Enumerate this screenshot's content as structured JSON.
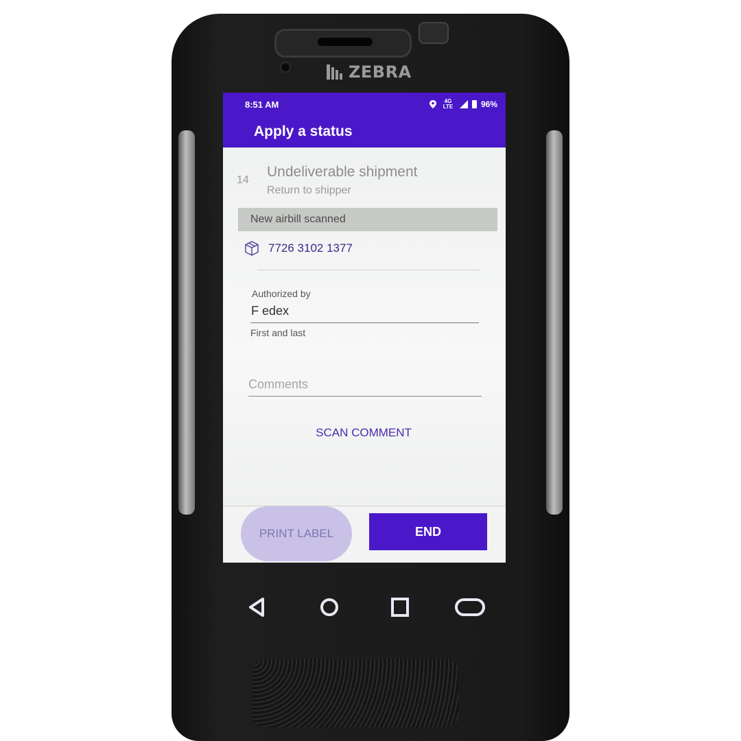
{
  "device": {
    "brand": "ZEBRA"
  },
  "statusbar": {
    "time": "8:51 AM",
    "network": "4G LTE",
    "battery": "96%"
  },
  "appbar": {
    "title": "Apply a status"
  },
  "status": {
    "code": "14",
    "title": "Undeliverable shipment",
    "subtitle": "Return to shipper"
  },
  "section": {
    "label": "New airbill scanned"
  },
  "airbill": {
    "number": "7726 3102 1377",
    "icon": "package-icon"
  },
  "authorized": {
    "label": "Authorized by",
    "value": "F edex",
    "helper": "First and last"
  },
  "comments": {
    "placeholder": "Comments",
    "scan_label": "SCAN COMMENT"
  },
  "footer": {
    "print_label": "PRINT LABEL",
    "end_label": "END"
  },
  "colors": {
    "accent": "#4a18c8",
    "print_button_bg": "#c9c2e6"
  },
  "navigation": [
    "back-icon",
    "home-icon",
    "recents-icon",
    "menu-icon"
  ]
}
